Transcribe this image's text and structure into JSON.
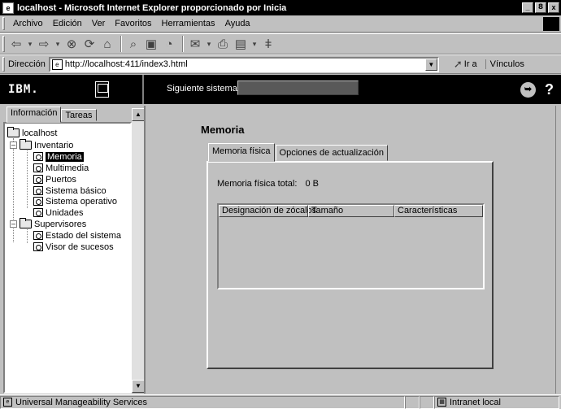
{
  "window": {
    "title": "localhost - Microsoft Internet Explorer proporcionado por Inicia",
    "controls": [
      "_",
      "8",
      "x"
    ]
  },
  "menu": {
    "items": [
      "Archivo",
      "Edición",
      "Ver",
      "Favoritos",
      "Herramientas",
      "Ayuda"
    ]
  },
  "toolbar": {
    "buttons": [
      "back-icon",
      "forward-icon",
      "stop-icon",
      "refresh-icon",
      "home-icon",
      "search-icon",
      "favorites-icon",
      "history-icon",
      "mail-icon",
      "print-icon",
      "edit-icon",
      "discuss-icon"
    ]
  },
  "address": {
    "label": "Dirección",
    "url": "http://localhost:411/index3.html",
    "go_label": "Ir a",
    "links_label": "Vínculos"
  },
  "header": {
    "logo": "IBM.",
    "next_system_label": "Siguiente sistema",
    "next_system_value": ""
  },
  "nav": {
    "tabs": [
      "Información",
      "Tareas"
    ],
    "active_tab": "Información",
    "tree": {
      "root": "localhost",
      "groups": [
        {
          "label": "Inventario",
          "items": [
            "Memoria",
            "Multimedia",
            "Puertos",
            "Sistema básico",
            "Sistema operativo",
            "Unidades"
          ]
        },
        {
          "label": "Supervisores",
          "items": [
            "Estado del sistema",
            "Visor de sucesos"
          ]
        }
      ],
      "selected": "Memoria"
    }
  },
  "main": {
    "title": "Memoria",
    "tabs": [
      "Memoria física",
      "Opciones de actualización"
    ],
    "active_tab": "Memoria física",
    "total_label": "Memoria física total:",
    "total_value": "0 B",
    "table": {
      "columns": [
        "Designación de zócalos",
        "Tamaño",
        "Características"
      ],
      "rows": []
    }
  },
  "status": {
    "text": "Universal Manageability Services",
    "zone": "Intranet local"
  }
}
